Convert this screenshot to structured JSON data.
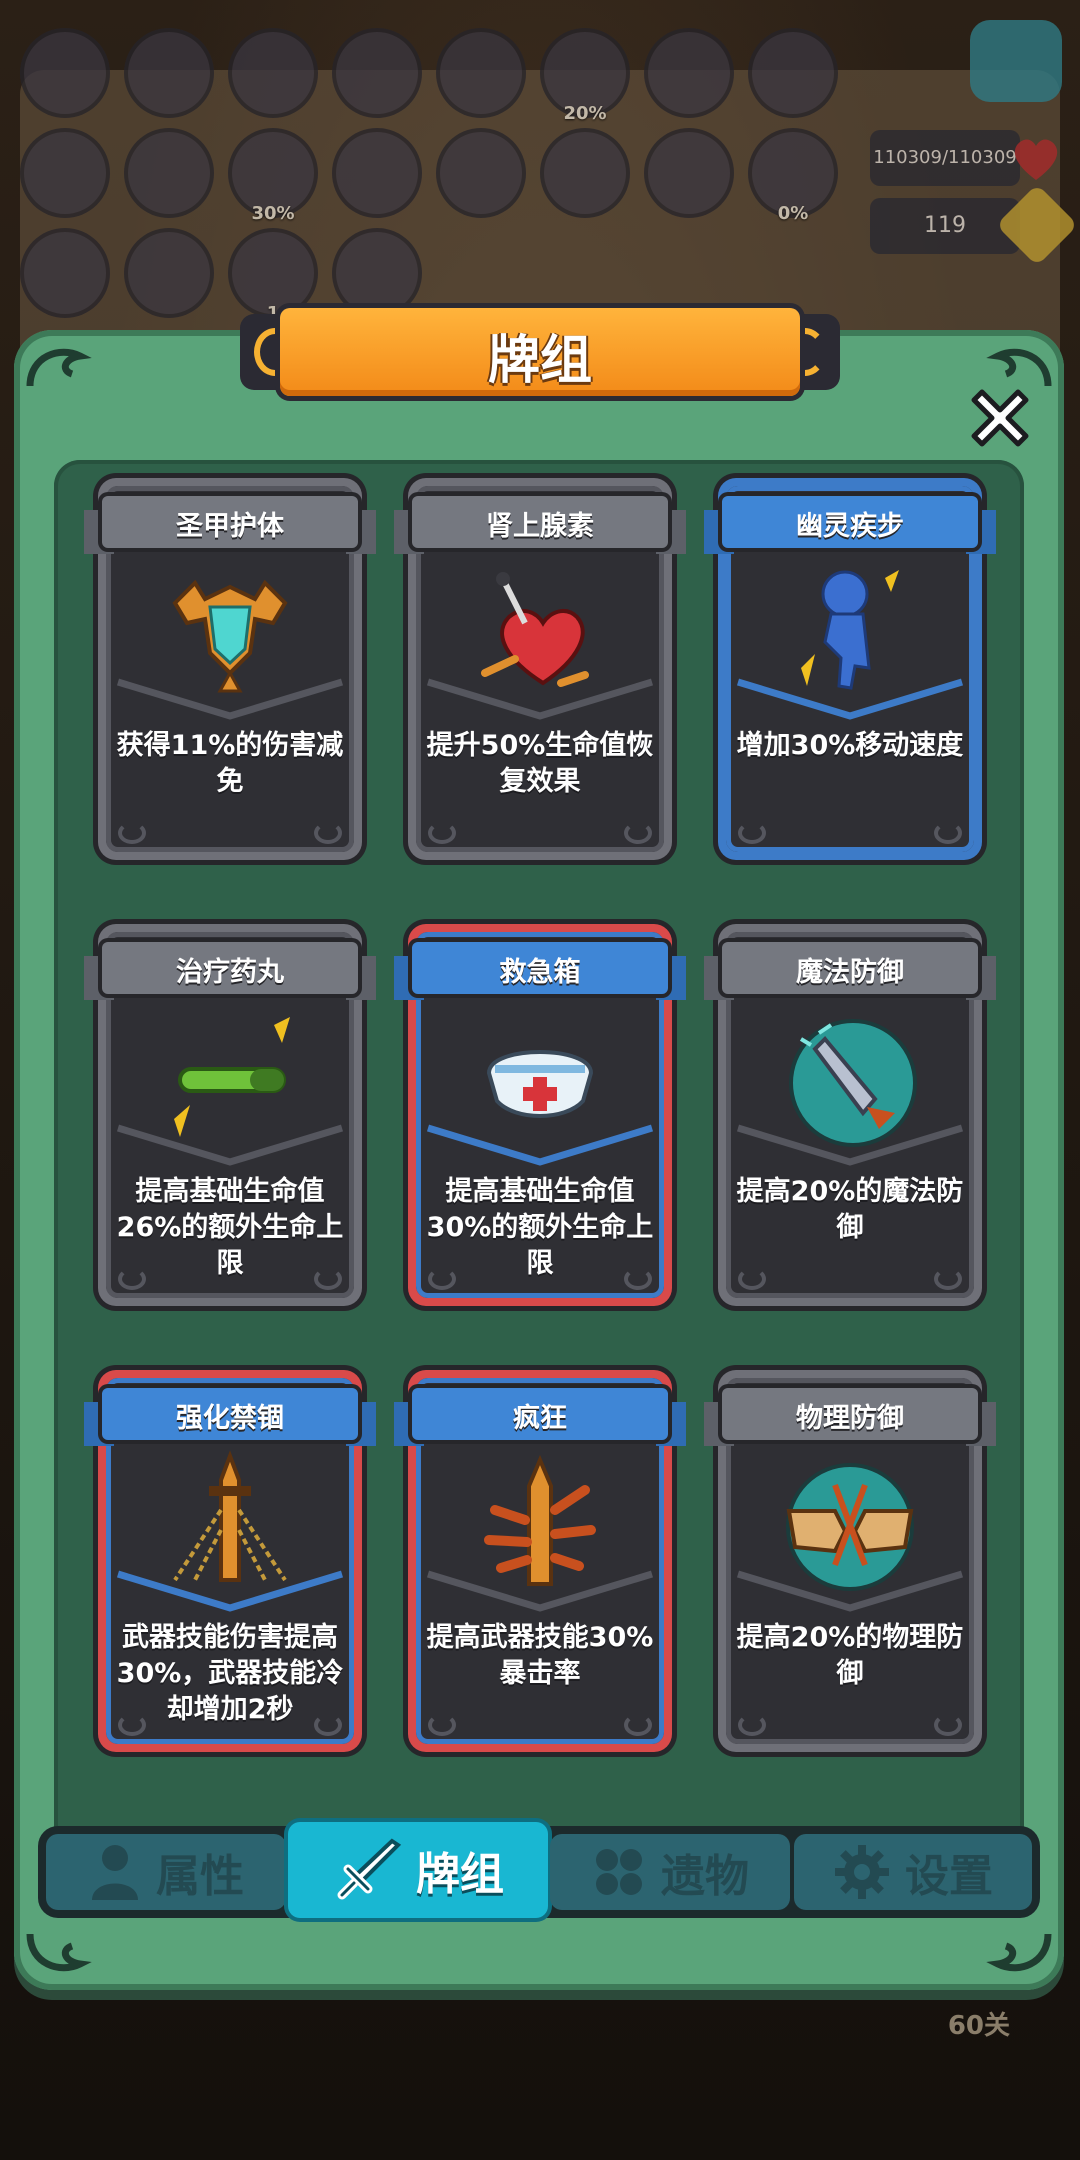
{
  "hud": {
    "slot_badges": [
      "20%",
      "30%",
      "0%",
      "1"
    ],
    "hp_text": "110309/110309",
    "coins": "119",
    "stage_label": "60关",
    "icons": [
      "heart-icon",
      "coin-icon",
      "pet-icon"
    ]
  },
  "panel": {
    "title": "牌组",
    "close_icon": "close-icon"
  },
  "cards": [
    {
      "name": "圣甲护体",
      "desc": "获得11%的伤害减免",
      "rarity": "gray",
      "icon": "armor-icon"
    },
    {
      "name": "肾上腺素",
      "desc": "提升50%生命值恢复效果",
      "rarity": "gray",
      "icon": "pierced-heart-icon"
    },
    {
      "name": "幽灵疾步",
      "desc": "增加30%移动速度",
      "rarity": "blue",
      "icon": "ghost-runner-icon"
    },
    {
      "name": "治疗药丸",
      "desc": "提高基础生命值26%的额外生命上限",
      "rarity": "gray",
      "icon": "pill-icon"
    },
    {
      "name": "救急箱",
      "desc": "提高基础生命值30%的额外生命上限",
      "rarity": "red",
      "icon": "first-aid-kit-icon"
    },
    {
      "name": "魔法防御",
      "desc": "提高20%的魔法防御",
      "rarity": "gray",
      "icon": "magic-shield-icon"
    },
    {
      "name": "强化禁锢",
      "desc": "武器技能伤害提高30%，武器技能冷却增加2秒",
      "rarity": "red",
      "icon": "chained-dagger-icon"
    },
    {
      "name": "疯狂",
      "desc": "提高武器技能30%暴击率",
      "rarity": "red",
      "icon": "frenzy-blade-icon"
    },
    {
      "name": "物理防御",
      "desc": "提高20%的物理防御",
      "rarity": "gray",
      "icon": "fist-shield-icon"
    }
  ],
  "tabs": [
    {
      "label": "属性",
      "icon": "person-icon",
      "active": false
    },
    {
      "label": "牌组",
      "icon": "sword-icon",
      "active": true
    },
    {
      "label": "遗物",
      "icon": "clover-icon",
      "active": false
    },
    {
      "label": "设置",
      "icon": "gear-icon",
      "active": false
    }
  ],
  "colors": {
    "panel": "#5aa47a",
    "banner": "#f6a127",
    "rarity_gray": "#6f7078",
    "rarity_blue": "#3d7bc8",
    "rarity_red": "#d94a4a",
    "tab_active": "#19b7d2"
  }
}
